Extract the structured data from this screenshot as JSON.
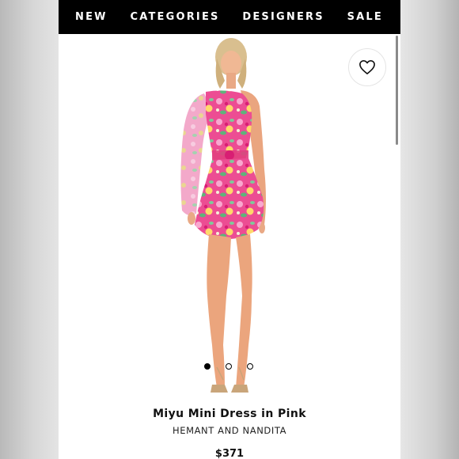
{
  "nav": {
    "items": [
      {
        "label": "NEW"
      },
      {
        "label": "CATEGORIES"
      },
      {
        "label": "DESIGNERS"
      },
      {
        "label": "SALE"
      }
    ]
  },
  "wishlist": {
    "icon": "heart-icon"
  },
  "gallery": {
    "image_count": 3,
    "active_index": 0
  },
  "product": {
    "title": "Miyu Mini Dress in Pink",
    "brand": "HEMANT AND NANDITA",
    "price": "$371"
  },
  "colors": {
    "nav_background": "#000000",
    "dress_pink": "#ec4d93",
    "page_background": "#ffffff"
  }
}
